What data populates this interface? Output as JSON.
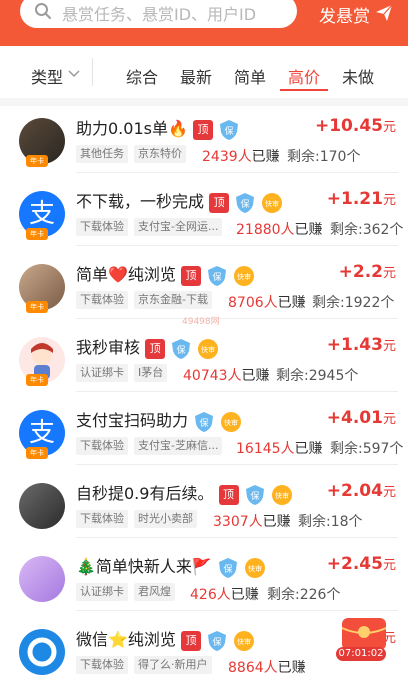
{
  "search": {
    "placeholder": "悬赏任务、悬赏ID、用户ID"
  },
  "post_label": "发悬赏",
  "filter": {
    "type_label": "类型",
    "tabs": [
      "综合",
      "最新",
      "简单",
      "高价",
      "未做"
    ],
    "active_tab": "高价"
  },
  "accent": "#f35936",
  "watermark": "49498网",
  "tasks": [
    {
      "title": "助力0.01s单🔥",
      "ding": "顶",
      "tags": [
        "其他任务",
        "京东特价"
      ],
      "earned_count": "2439人",
      "earned_suffix": "已赚",
      "remain": "剩余:170个",
      "price": "+10.45",
      "unit": "元"
    },
    {
      "title": "不下载，一秒完成",
      "ding": "顶",
      "tags": [
        "下载体验",
        "支付宝-全网运..."
      ],
      "earned_count": "21880人",
      "earned_suffix": "已赚",
      "remain": "剩余:362个",
      "price": "+1.21",
      "unit": "元"
    },
    {
      "title": "简单❤️纯浏览",
      "ding": "顶",
      "tags": [
        "下载体验",
        "京东金融-下载"
      ],
      "earned_count": "8706人",
      "earned_suffix": "已赚",
      "remain": "剩余:1922个",
      "price": "+2.2",
      "unit": "元"
    },
    {
      "title": "我秒审核",
      "ding": "顶",
      "tags": [
        "认证绑卡",
        "I茅台"
      ],
      "earned_count": "40743人",
      "earned_suffix": "已赚",
      "remain": "剩余:2945个",
      "price": "+1.43",
      "unit": "元"
    },
    {
      "title": "支付宝扫码助力",
      "ding": "",
      "tags": [
        "下载体验",
        "支付宝-芝麻信..."
      ],
      "earned_count": "16145人",
      "earned_suffix": "已赚",
      "remain": "剩余:597个",
      "price": "+4.01",
      "unit": "元"
    },
    {
      "title": "自秒提0.9有后续。",
      "ding": "顶",
      "tags": [
        "下载体验",
        "时光小卖部"
      ],
      "earned_count": "3307人",
      "earned_suffix": "已赚",
      "remain": "剩余:18个",
      "price": "+2.04",
      "unit": "元"
    },
    {
      "title": "🎄简单快新人来🚩",
      "ding": "",
      "tags": [
        "认证绑卡",
        "君风煌"
      ],
      "earned_count": "426人",
      "earned_suffix": "已赚",
      "remain": "剩余:226个",
      "price": "+2.45",
      "unit": "元"
    },
    {
      "title": "微信⭐纯浏览",
      "ding": "顶",
      "tags": [
        "下载体验",
        "得了么·新用户"
      ],
      "earned_count": "8864人",
      "earned_suffix": "已赚",
      "remain": "",
      "price": "",
      "unit": "元"
    }
  ],
  "avatar_badge": "年卡",
  "quick_label": "快审",
  "shield_label": "保",
  "timer": "07:01:02"
}
